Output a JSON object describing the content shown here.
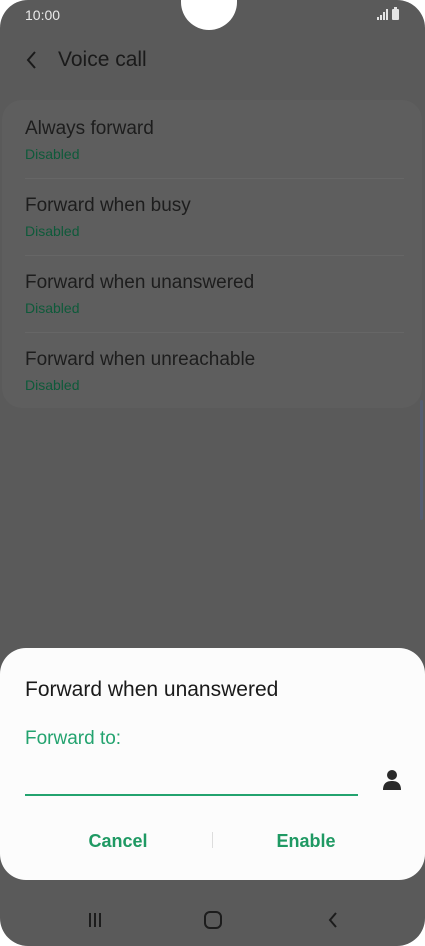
{
  "status_bar": {
    "time": "10:00"
  },
  "header": {
    "title": "Voice call"
  },
  "settings": [
    {
      "title": "Always forward",
      "status": "Disabled"
    },
    {
      "title": "Forward when busy",
      "status": "Disabled"
    },
    {
      "title": "Forward when unanswered",
      "status": "Disabled"
    },
    {
      "title": "Forward when unreachable",
      "status": "Disabled"
    }
  ],
  "dialog": {
    "title": "Forward when unanswered",
    "field_label": "Forward to:",
    "field_value": "",
    "cancel_label": "Cancel",
    "enable_label": "Enable"
  },
  "icons": {
    "back": "chevron-left-icon",
    "contact": "person-icon",
    "nav_recents": "recents-icon",
    "nav_home": "home-icon",
    "nav_back": "back-icon"
  },
  "colors": {
    "accent": "#23a36f",
    "status_text": "#0e5a3a",
    "dim_background": "#5a5a5a",
    "dialog_background": "#fcfcfc"
  }
}
